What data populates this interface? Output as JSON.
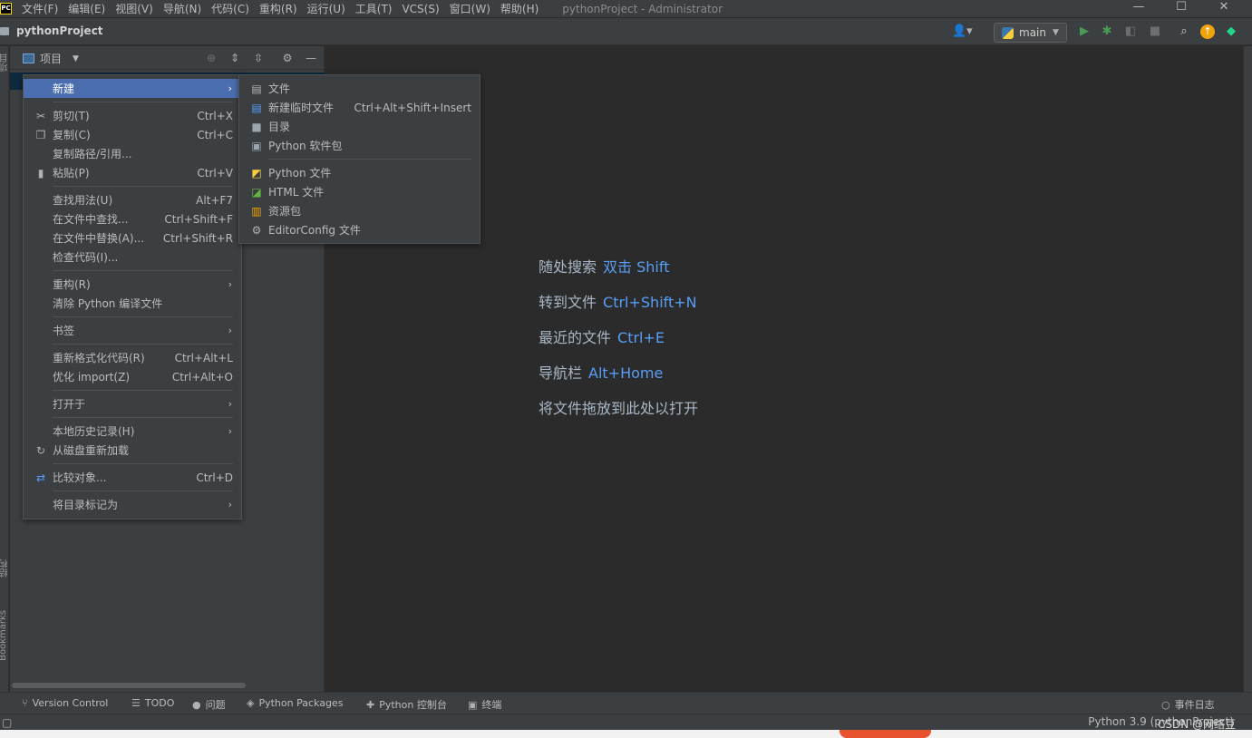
{
  "app": {
    "logo_text": "PC",
    "menu": [
      "文件(F)",
      "编辑(E)",
      "视图(V)",
      "导航(N)",
      "代码(C)",
      "重构(R)",
      "运行(U)",
      "工具(T)",
      "VCS(S)",
      "窗口(W)",
      "帮助(H)"
    ],
    "window_title": "pythonProject - Administrator",
    "win_controls": [
      "—",
      "☐",
      "✕"
    ]
  },
  "toolbar": {
    "project_name": "pythonProject",
    "run_config": "main",
    "icons": [
      "user-icon",
      "run-icon",
      "debug-icon",
      "coverage-icon",
      "stop-icon",
      "search-icon",
      "update-icon",
      "plugin-icon"
    ]
  },
  "project_panel": {
    "title": "项目"
  },
  "left_stripe": {
    "project_label": "项目",
    "structure_label": "结构",
    "bookmarks_label": "Bookmarks"
  },
  "context_menu": {
    "items": [
      {
        "label": "新建",
        "shortcut": "",
        "submenu": true
      },
      {
        "label": "剪切(T)",
        "shortcut": "Ctrl+X",
        "icon": "cut-icon"
      },
      {
        "label": "复制(C)",
        "shortcut": "Ctrl+C",
        "icon": "copy-icon"
      },
      {
        "label": "复制路径/引用...",
        "shortcut": ""
      },
      {
        "label": "粘贴(P)",
        "shortcut": "Ctrl+V",
        "icon": "paste-icon"
      },
      {
        "label": "查找用法(U)",
        "shortcut": "Alt+F7"
      },
      {
        "label": "在文件中查找...",
        "shortcut": "Ctrl+Shift+F"
      },
      {
        "label": "在文件中替换(A)...",
        "shortcut": "Ctrl+Shift+R"
      },
      {
        "label": "检查代码(I)...",
        "shortcut": ""
      },
      {
        "label": "重构(R)",
        "shortcut": "",
        "submenu": true
      },
      {
        "label": "清除 Python 编译文件",
        "shortcut": ""
      },
      {
        "label": "书签",
        "shortcut": "",
        "submenu": true
      },
      {
        "label": "重新格式化代码(R)",
        "shortcut": "Ctrl+Alt+L"
      },
      {
        "label": "优化 import(Z)",
        "shortcut": "Ctrl+Alt+O"
      },
      {
        "label": "打开于",
        "shortcut": "",
        "submenu": true
      },
      {
        "label": "本地历史记录(H)",
        "shortcut": "",
        "submenu": true
      },
      {
        "label": "从磁盘重新加载",
        "shortcut": "",
        "icon": "reload-icon"
      },
      {
        "label": "比较对象...",
        "shortcut": "Ctrl+D",
        "icon": "compare-icon"
      },
      {
        "label": "将目录标记为",
        "shortcut": "",
        "submenu": true
      }
    ]
  },
  "new_submenu": {
    "items": [
      {
        "label": "文件",
        "shortcut": "",
        "icon": "file-icon"
      },
      {
        "label": "新建临时文件",
        "shortcut": "Ctrl+Alt+Shift+Insert",
        "icon": "scratch-file-icon"
      },
      {
        "label": "目录",
        "shortcut": "",
        "icon": "folder-icon"
      },
      {
        "label": "Python 软件包",
        "shortcut": "",
        "icon": "package-icon"
      },
      {
        "label": "Python 文件",
        "shortcut": "",
        "icon": "python-file-icon"
      },
      {
        "label": "HTML 文件",
        "shortcut": "",
        "icon": "html-file-icon"
      },
      {
        "label": "资源包",
        "shortcut": "",
        "icon": "resource-bundle-icon"
      },
      {
        "label": "EditorConfig 文件",
        "shortcut": "",
        "icon": "gear-icon"
      }
    ]
  },
  "welcome": {
    "hints": [
      {
        "text": "随处搜索",
        "key": "双击 Shift"
      },
      {
        "text": "转到文件",
        "key": "Ctrl+Shift+N"
      },
      {
        "text": "最近的文件",
        "key": "Ctrl+E"
      },
      {
        "text": "导航栏",
        "key": "Alt+Home"
      },
      {
        "text": "将文件拖放到此处以打开",
        "key": ""
      }
    ]
  },
  "bottom_bar": {
    "items": [
      "Version Control",
      "TODO",
      "问题",
      "Python Packages",
      "Python 控制台",
      "终端"
    ],
    "event_log": "事件日志"
  },
  "status_bar": {
    "interpreter": "Python 3.9 (pythonProject)",
    "watermark": "CSDN @网络豆"
  },
  "colors": {
    "accent": "#4b6eaf",
    "shortcut_key": "#589df6",
    "background": "#2b2b2b",
    "panel": "#3c3f41"
  }
}
